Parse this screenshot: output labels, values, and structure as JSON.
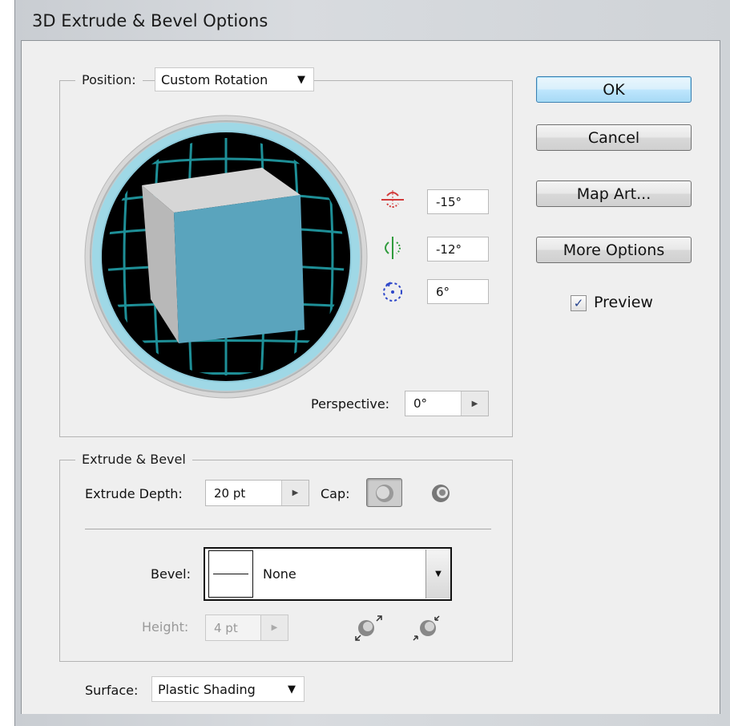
{
  "window": {
    "title": "3D Extrude & Bevel Options"
  },
  "position": {
    "label": "Position:",
    "selected": "Custom Rotation",
    "rotation": {
      "x_value": "-15°",
      "y_value": "-12°",
      "z_value": "6°"
    },
    "perspective_label": "Perspective:",
    "perspective_value": "0°"
  },
  "extrude_bevel": {
    "legend": "Extrude & Bevel",
    "extrude_depth_label": "Extrude Depth:",
    "extrude_depth_value": "20 pt",
    "cap_label": "Cap:",
    "bevel_label": "Bevel:",
    "bevel_value": "None",
    "height_label": "Height:",
    "height_value": "4 pt"
  },
  "surface": {
    "label": "Surface:",
    "selected": "Plastic Shading"
  },
  "buttons": {
    "ok": "OK",
    "cancel": "Cancel",
    "map_art": "Map Art...",
    "more_options": "More Options"
  },
  "preview": {
    "label": "Preview",
    "checked": true
  },
  "colors": {
    "cube_front": "#5aa4bd",
    "cube_side": "#b8b8b8",
    "cube_top": "#d6d6d6",
    "track_grid": "#1e8f97",
    "x_axis": "#d23b3b",
    "y_axis": "#2f9b3c",
    "z_axis": "#2d46c9"
  },
  "icons": [
    "chevron-down-icon",
    "chevron-right-icon",
    "rotate-x-icon",
    "rotate-y-icon",
    "rotate-z-icon",
    "cap-on-icon",
    "cap-off-icon",
    "bevel-out-icon",
    "bevel-in-icon",
    "checkbox-check-icon"
  ]
}
